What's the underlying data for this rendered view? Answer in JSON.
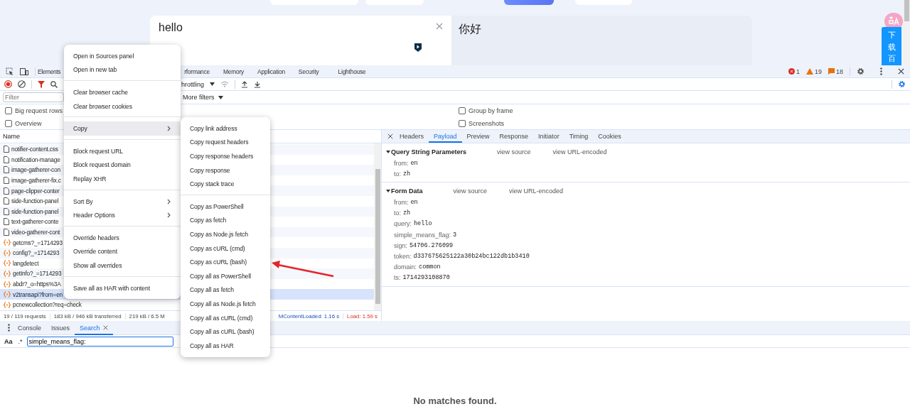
{
  "web_page": {
    "source_text": "hello",
    "translation": "你好",
    "side_button": "下载百"
  },
  "devtools": {
    "panel_tabs": [
      {
        "label": "Elements",
        "selected": false
      },
      {
        "label": "rformance",
        "selected": false
      },
      {
        "label": "Memory",
        "selected": false
      },
      {
        "label": "Application",
        "selected": false
      },
      {
        "label": "Security",
        "selected": false
      },
      {
        "label": "Lighthouse",
        "selected": false
      }
    ],
    "counts": {
      "errors": "1",
      "warnings": "19",
      "issues": "18"
    },
    "throttling": "hrottling",
    "filter_placeholder": "Filter",
    "more_filters": "More filters",
    "options": [
      {
        "label": "Big request rows",
        "checked": false
      },
      {
        "label": "Overview",
        "checked": false
      },
      {
        "label": "Group by frame",
        "checked": false
      },
      {
        "label": "Screenshots",
        "checked": false
      }
    ],
    "requests": {
      "column": "Name",
      "rows": [
        {
          "name": "notifier-content.css",
          "kind": "file",
          "selected": false
        },
        {
          "name": "notification-manage",
          "kind": "file",
          "selected": false
        },
        {
          "name": "image-gatherer-con",
          "kind": "file",
          "selected": false
        },
        {
          "name": "image-gatherer-fix.c",
          "kind": "file",
          "selected": false
        },
        {
          "name": "page-clipper-conter",
          "kind": "file",
          "selected": false
        },
        {
          "name": "side-function-panel",
          "kind": "file",
          "selected": false
        },
        {
          "name": "side-function-panel",
          "kind": "file",
          "selected": false
        },
        {
          "name": "text-gatherer-conte",
          "kind": "file",
          "selected": false
        },
        {
          "name": "video-gatherer-cont",
          "kind": "file",
          "selected": false
        },
        {
          "name": "getcms?_=1714293",
          "kind": "xhr",
          "selected": false
        },
        {
          "name": "config?_=1714293",
          "kind": "xhr",
          "selected": false
        },
        {
          "name": "langdetect",
          "kind": "xhr",
          "selected": false
        },
        {
          "name": "getInfo?_=1714293",
          "kind": "xhr",
          "selected": false
        },
        {
          "name": "abdr?_o=https%3A",
          "kind": "xhr",
          "selected": false
        },
        {
          "name": "v2transapi?from=en",
          "kind": "xhr",
          "selected": true
        },
        {
          "name": "pcnewcollection?req=check",
          "kind": "xhr",
          "selected": false
        }
      ]
    },
    "summary": [
      "19 / 119 requests",
      "183 kB / 946 kB transferred",
      "219 kB / 6.5 M"
    ],
    "dom_content_loaded": "MContentLoaded: 1.16 s",
    "load": "Load: 1.59 s",
    "detail_tabs": [
      {
        "label": "Headers",
        "selected": false
      },
      {
        "label": "Payload",
        "selected": true
      },
      {
        "label": "Preview",
        "selected": false
      },
      {
        "label": "Response",
        "selected": false
      },
      {
        "label": "Initiator",
        "selected": false
      },
      {
        "label": "Timing",
        "selected": false
      },
      {
        "label": "Cookies",
        "selected": false
      }
    ],
    "payload": [
      {
        "title": "Query String Parameters",
        "expanded": true,
        "links": [
          "view source",
          "view URL-encoded"
        ],
        "params": [
          {
            "key": "from:",
            "value": "en"
          },
          {
            "key": "to:",
            "value": "zh"
          }
        ]
      },
      {
        "title": "Form Data",
        "expanded": true,
        "links": [
          "view source",
          "view URL-encoded"
        ],
        "params": [
          {
            "key": "from:",
            "value": "en"
          },
          {
            "key": "to:",
            "value": "zh"
          },
          {
            "key": "query:",
            "value": "hello"
          },
          {
            "key": "simple_means_flag:",
            "value": "3"
          },
          {
            "key": "sign:",
            "value": "54706.276099"
          },
          {
            "key": "token:",
            "value": "d337675625122a30b24bc122db1b3410"
          },
          {
            "key": "domain:",
            "value": "common"
          },
          {
            "key": "ts:",
            "value": "1714293108870"
          }
        ]
      }
    ],
    "drawer_tabs": [
      {
        "label": "Console",
        "selected": false,
        "closable": false
      },
      {
        "label": "Issues",
        "selected": false,
        "closable": false
      },
      {
        "label": "Search",
        "selected": true,
        "closable": true
      }
    ],
    "search": {
      "case_toggle": "Aa",
      "regex_toggle": ".*",
      "value": "simple_means_flag:",
      "result": "No matches found."
    }
  },
  "context_menu": {
    "groups": [
      [
        {
          "label": "Open in Sources panel",
          "highlighted": false,
          "submenu": false
        },
        {
          "label": "Open in new tab",
          "highlighted": false,
          "submenu": false
        }
      ],
      [
        {
          "label": "Clear browser cache",
          "highlighted": false,
          "submenu": false
        },
        {
          "label": "Clear browser cookies",
          "highlighted": false,
          "submenu": false
        }
      ],
      [
        {
          "label": "Copy",
          "highlighted": true,
          "submenu": true
        }
      ],
      [
        {
          "label": "Block request URL",
          "highlighted": false,
          "submenu": false
        },
        {
          "label": "Block request domain",
          "highlighted": false,
          "submenu": false
        },
        {
          "label": "Replay XHR",
          "highlighted": false,
          "submenu": false
        }
      ],
      [
        {
          "label": "Sort By",
          "highlighted": false,
          "submenu": true
        },
        {
          "label": "Header Options",
          "highlighted": false,
          "submenu": true
        }
      ],
      [
        {
          "label": "Override headers",
          "highlighted": false,
          "submenu": false
        },
        {
          "label": "Override content",
          "highlighted": false,
          "submenu": false
        },
        {
          "label": "Show all overrides",
          "highlighted": false,
          "submenu": false
        }
      ],
      [
        {
          "label": "Save all as HAR with content",
          "highlighted": false,
          "submenu": false
        }
      ]
    ]
  },
  "copy_submenu": {
    "groups": [
      [
        {
          "label": "Copy link address",
          "highlighted": false,
          "submenu": false
        },
        {
          "label": "Copy request headers",
          "highlighted": false,
          "submenu": false
        },
        {
          "label": "Copy response headers",
          "highlighted": false,
          "submenu": false
        },
        {
          "label": "Copy response",
          "highlighted": false,
          "submenu": false
        },
        {
          "label": "Copy stack trace",
          "highlighted": false,
          "submenu": false
        }
      ],
      [
        {
          "label": "Copy as PowerShell",
          "highlighted": false,
          "submenu": false
        },
        {
          "label": "Copy as fetch",
          "highlighted": false,
          "submenu": false
        },
        {
          "label": "Copy as Node.js fetch",
          "highlighted": false,
          "submenu": false
        },
        {
          "label": "Copy as cURL (cmd)",
          "highlighted": false,
          "submenu": false
        },
        {
          "label": "Copy as cURL (bash)",
          "highlighted": false,
          "submenu": false
        },
        {
          "label": "Copy all as PowerShell",
          "highlighted": false,
          "submenu": false
        },
        {
          "label": "Copy all as fetch",
          "highlighted": false,
          "submenu": false
        },
        {
          "label": "Copy all as Node.js fetch",
          "highlighted": false,
          "submenu": false
        },
        {
          "label": "Copy all as cURL (cmd)",
          "highlighted": false,
          "submenu": false
        },
        {
          "label": "Copy all as cURL (bash)",
          "highlighted": false,
          "submenu": false
        },
        {
          "label": "Copy all as HAR",
          "highlighted": false,
          "submenu": false
        }
      ]
    ]
  }
}
